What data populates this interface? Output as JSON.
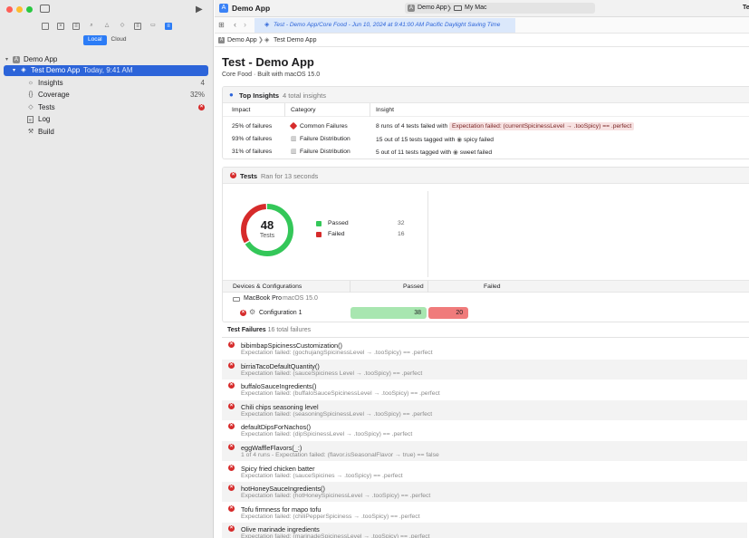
{
  "colors": {
    "accent": "#2c64d9",
    "passed": "#34c759",
    "failed": "#d62b2b",
    "passed_bar": "#a8e6b0",
    "failed_bar": "#f07b7b"
  },
  "sidebar": {
    "segments": [
      {
        "label": "Local",
        "selected": true
      },
      {
        "label": "Cloud",
        "selected": false
      }
    ],
    "project": "Demo App",
    "test_run": {
      "name": "Test Demo App",
      "time": "Today, 9:41 AM"
    },
    "items": [
      {
        "label": "Insights",
        "count": "4",
        "icon": "lightbulb-icon"
      },
      {
        "label": "Coverage",
        "count": "32%",
        "icon": "braces-icon"
      },
      {
        "label": "Tests",
        "count": "",
        "icon": "diamond-icon",
        "failed": true
      },
      {
        "label": "Log",
        "count": "",
        "icon": "log-icon"
      },
      {
        "label": "Build",
        "count": "",
        "icon": "hammer-icon"
      }
    ]
  },
  "tabbar": {
    "title": "Demo App",
    "scheme": "Demo App",
    "destination": "My Mac",
    "right_truncated": "Te"
  },
  "jumpbar": {
    "path": "Test - Demo App/Core Food - Jun 10, 2024 at 9:41:00 AM Pacific Daylight Saving Time"
  },
  "breadcrumb": [
    "Demo App",
    "Test Demo App"
  ],
  "report": {
    "title": "Test - Demo App",
    "subtitle": "Core Food · Built with macOS 15.0"
  },
  "insights": {
    "title": "Top Insights",
    "count_text": "4 total insights",
    "columns": [
      "Impact",
      "Category",
      "Insight"
    ],
    "rows": [
      {
        "impact": "25% of failures",
        "category": "Common Failures",
        "insight_prefix": "8 runs of 4 tests failed with",
        "insight_chip": "Expectation failed: (currentSpicinessLevel → .tooSpicy) == .perfect"
      },
      {
        "impact": "93% of failures",
        "category": "Failure Distribution",
        "insight_prefix": "15 out of 15 tests tagged with",
        "insight_chip": "spicy failed"
      },
      {
        "impact": "31% of failures",
        "category": "Failure Distribution",
        "insight_prefix": "5 out of 11 tests tagged with",
        "insight_chip": "sweet failed"
      }
    ]
  },
  "tests": {
    "title": "Tests",
    "duration": "Ran for 13 seconds",
    "total": "48",
    "total_label": "Tests",
    "legend": [
      {
        "label": "Passed",
        "value": "32"
      },
      {
        "label": "Failed",
        "value": "16"
      }
    ],
    "chart_data": {
      "type": "pie",
      "categories": [
        "Passed",
        "Failed"
      ],
      "values": [
        32,
        16
      ],
      "colors": [
        "#34c759",
        "#d62b2b"
      ]
    },
    "device_header": {
      "col1": "Devices & Configurations",
      "col2": "Passed",
      "col3": "Failed"
    },
    "device": {
      "name": "MacBook Pro",
      "os": "macOS 15.0"
    },
    "configuration": {
      "name": "Configuration 1",
      "passed": 38,
      "failed": 20
    }
  },
  "failures": {
    "title": "Test Failures",
    "count_text": "16 total failures",
    "items": [
      {
        "name": "bibimbapSpicinessCustomization()",
        "message": "Expectation failed: (gochujangSpicinessLevel → .tooSpicy) == .perfect"
      },
      {
        "name": "birriaTacoDefaultQuantity()",
        "message": "Expectation failed: (sauceSpiciness Level → .tooSpicy) == .perfect"
      },
      {
        "name": "buffaloSauceIngredients()",
        "message": "Expectation failed: (buffaloSauceSpicinessLevel → .tooSpicy) == .perfect"
      },
      {
        "name": "Chili chips seasoning level",
        "message": "Expectation failed: (seasoningSpicinessLevel → .tooSpicy) == .perfect"
      },
      {
        "name": "defaultDipsForNachos()",
        "message": "Expectation failed: (dipSpicinessLevel → .tooSpicy) == .perfect"
      },
      {
        "name": "eggWaffleFlavors(_:)",
        "message": "1 of 4 runs - Expectation failed: (flavor.isSeasonalFlavor → true) == false"
      },
      {
        "name": "Spicy fried chicken batter",
        "message": "Expectation failed: (sauceSpicines → .tooSpicy) == .perfect"
      },
      {
        "name": "hotHoneySauceIngredients()",
        "message": "Expectation failed: (hotHoneySpicinessLevel → .tooSpicy) == .perfect"
      },
      {
        "name": "Tofu firmness for mapo tofu",
        "message": "Expectation failed: (chiliPepperSpiciness → .tooSpicy) == .perfect"
      },
      {
        "name": "Olive marinade ingredients",
        "message": "Expectation failed: (marinadeSpicinessLevel → .tooSpicy) == .perfect"
      }
    ]
  }
}
